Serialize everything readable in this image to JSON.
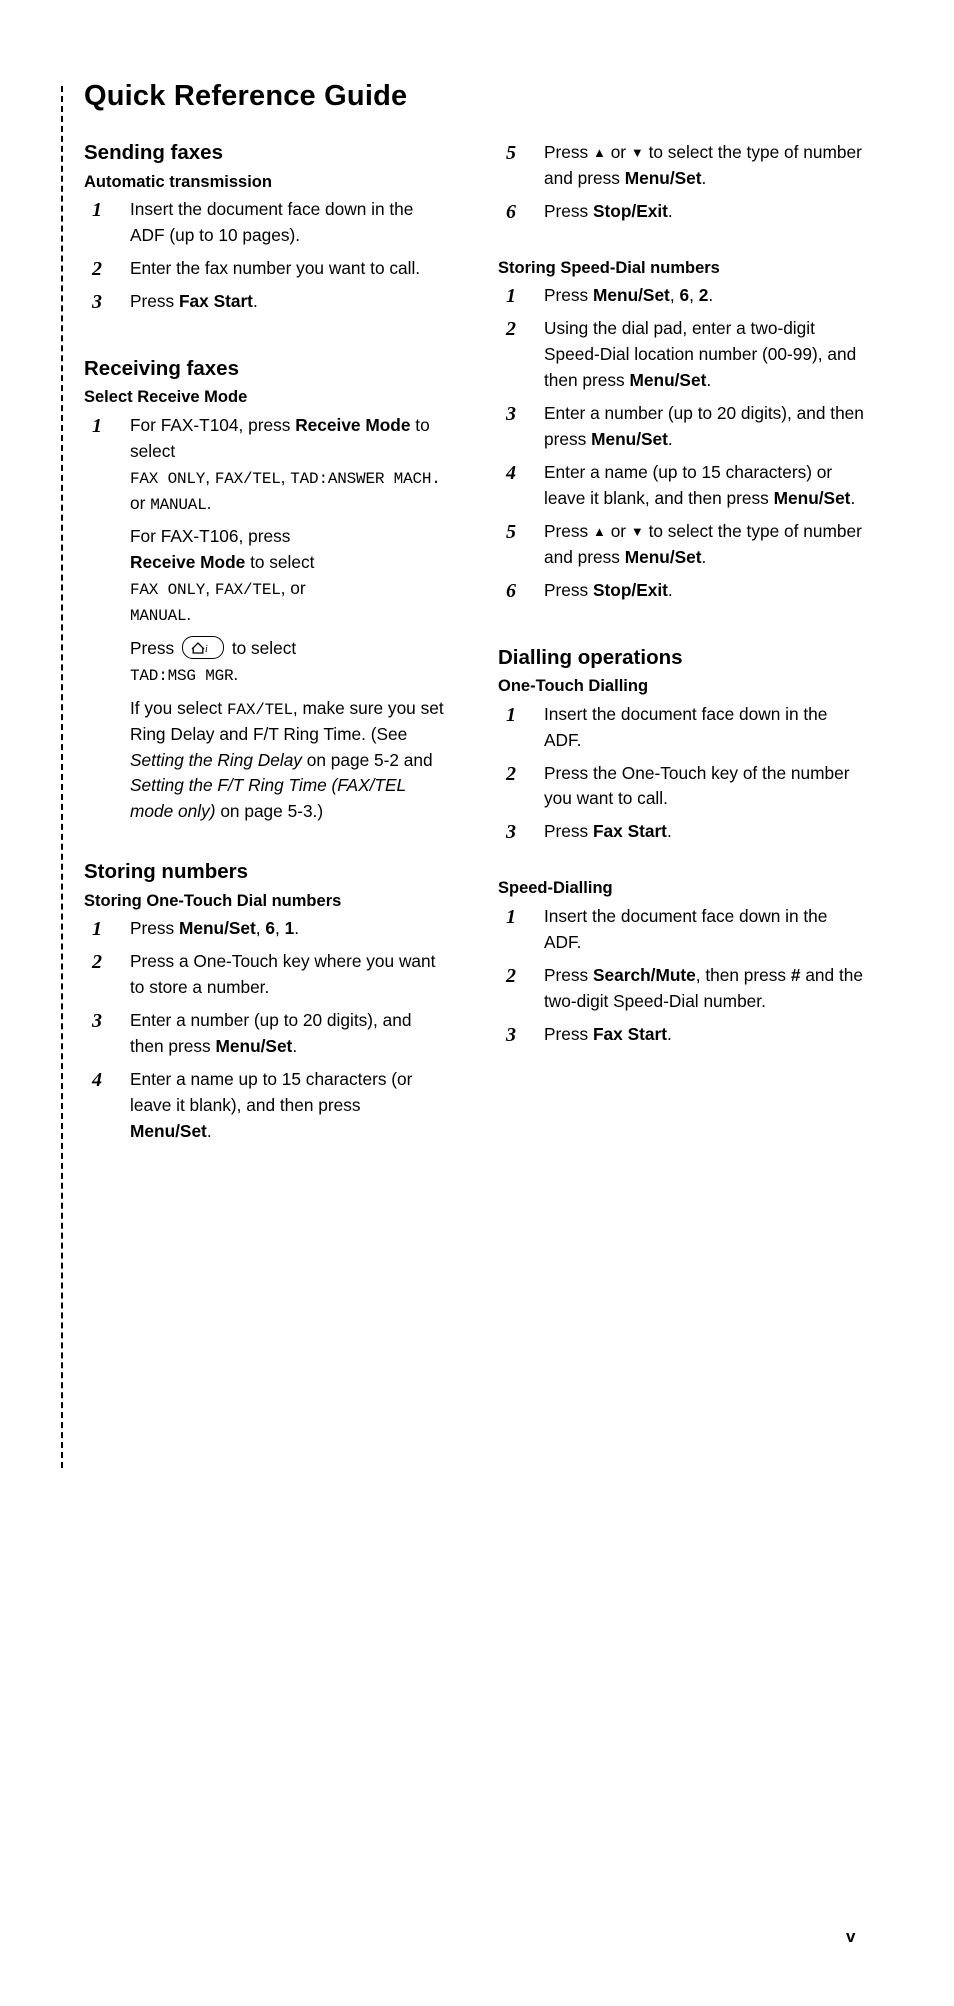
{
  "document": {
    "title": "Quick Reference Guide",
    "page_number": "v"
  },
  "left_column": {
    "sections": [
      {
        "heading": "Sending faxes",
        "subheading": "Automatic transmission",
        "steps": [
          "Insert the document face down in the ADF (up to 10 pages).",
          "Enter the fax number you want to call.",
          "Press Fax Start."
        ]
      },
      {
        "heading": "Receiving faxes",
        "subheading": "Select Receive Mode",
        "step1_line1": "For FAX-T104, press",
        "step1_receive_mode": "Receive Mode",
        "step1_to_select": "to select",
        "step1_modes_a": "FAX ONLY",
        "step1_modes_b": "FAX/TEL",
        "step1_modes_c": "TAD:ANSWER MACH.",
        "step1_or": "or",
        "step1_modes_d": "MANUAL",
        "step1_line2": "For FAX-T106, press",
        "step1_modes_e": "FAX ONLY",
        "step1_modes_f": "FAX/TEL",
        "step1_or2": "or",
        "step1_modes_g": "MANUAL",
        "press_label": "Press",
        "to_select_label": "to select",
        "tad_msg_mgr": "TAD:MSG MGR",
        "note_a": "If you select",
        "note_faxtel": "FAX/TEL",
        "note_b": ", make sure you set Ring Delay and F/T Ring Time. (See",
        "note_italic1": "Setting the Ring Delay",
        "note_c": "on page 5-2 and",
        "note_italic2": "Setting the F/T Ring Time (FAX/TEL mode only)",
        "note_d": "on page 5-3.)"
      },
      {
        "heading": "Storing numbers",
        "subheading": "Storing One-Touch Dial numbers",
        "steps": [
          "Press Menu/Set, 6, 1.",
          "Press a One-Touch key where you want to store a number.",
          "Enter a number (up to 20 digits), and then press Menu/Set.",
          "Enter a name up to 15 characters (or leave it blank), and then press Menu/Set."
        ]
      }
    ]
  },
  "right_column": {
    "continued_steps": {
      "step5_a": "Press",
      "step5_b": "or",
      "step5_c": "to select the type of number and press",
      "step5_d": "Menu/Set",
      "step5_e": ".",
      "step6_a": "Press",
      "step6_b": "Stop/Exit",
      "step6_c": "."
    },
    "sections": [
      {
        "subheading": "Storing Speed-Dial numbers",
        "step1_a": "Press",
        "step1_b": "Menu/Set",
        "step1_c": ",",
        "step1_d": "6",
        "step1_e": ",",
        "step1_f": "2",
        "step1_g": ".",
        "step2_a": "Using the dial pad, enter a two-digit Speed-Dial location number (00-99), and then press",
        "step2_b": "Menu/Set",
        "step2_c": ".",
        "step3_a": "Enter a number (up to 20 digits), and then press",
        "step3_b": "Menu/Set",
        "step3_c": ".",
        "step4_a": "Enter a name (up to 15 characters) or leave it blank, and then press",
        "step4_b": "Menu/Set",
        "step4_c": ".",
        "step5_a": "Press",
        "step5_b": "or",
        "step5_c": "to select the type of number and press",
        "step5_d": "Menu/Set",
        "step5_e": ".",
        "step6_a": "Press",
        "step6_b": "Stop/Exit",
        "step6_c": "."
      },
      {
        "heading": "Dialling operations",
        "subheading": "One-Touch Dialling",
        "steps": [
          "Insert the document face down in the ADF.",
          "Press the One-Touch key of the number you want to call.",
          "Press Fax Start."
        ]
      },
      {
        "subheading": "Speed-Dialling",
        "step1": "Insert the document face down in the ADF.",
        "step2_a": "Press",
        "step2_b": "Search/Mute",
        "step2_c": ", then press",
        "step2_d": "#",
        "step2_e": "and the two-digit Speed-Dial number.",
        "step3_a": "Press",
        "step3_b": "Fax Start",
        "step3_c": "."
      }
    ]
  },
  "icons": {
    "up_arrow": "▲",
    "down_arrow": "▼",
    "tad_key": "tad-house-icon"
  }
}
